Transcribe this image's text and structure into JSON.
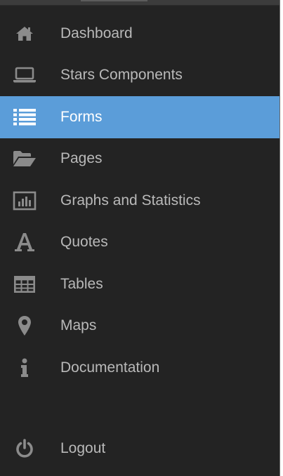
{
  "sidebar": {
    "items": [
      {
        "label": "Dashboard",
        "icon": "home-icon"
      },
      {
        "label": "Stars Components",
        "icon": "laptop-icon"
      },
      {
        "label": "Forms",
        "icon": "list-icon",
        "active": true
      },
      {
        "label": "Pages",
        "icon": "folder-open-icon"
      },
      {
        "label": "Graphs and Statistics",
        "icon": "bar-chart-icon"
      },
      {
        "label": "Quotes",
        "icon": "font-icon"
      },
      {
        "label": "Tables",
        "icon": "table-icon"
      },
      {
        "label": "Maps",
        "icon": "map-marker-icon"
      },
      {
        "label": "Documentation",
        "icon": "info-icon"
      }
    ],
    "logout": {
      "label": "Logout",
      "icon": "power-icon"
    }
  },
  "colors": {
    "sidebar_bg": "#232323",
    "active_bg": "#5b9dd9",
    "text": "#b9b9b9",
    "icon": "#8b8b8b",
    "active_text": "#ffffff"
  }
}
